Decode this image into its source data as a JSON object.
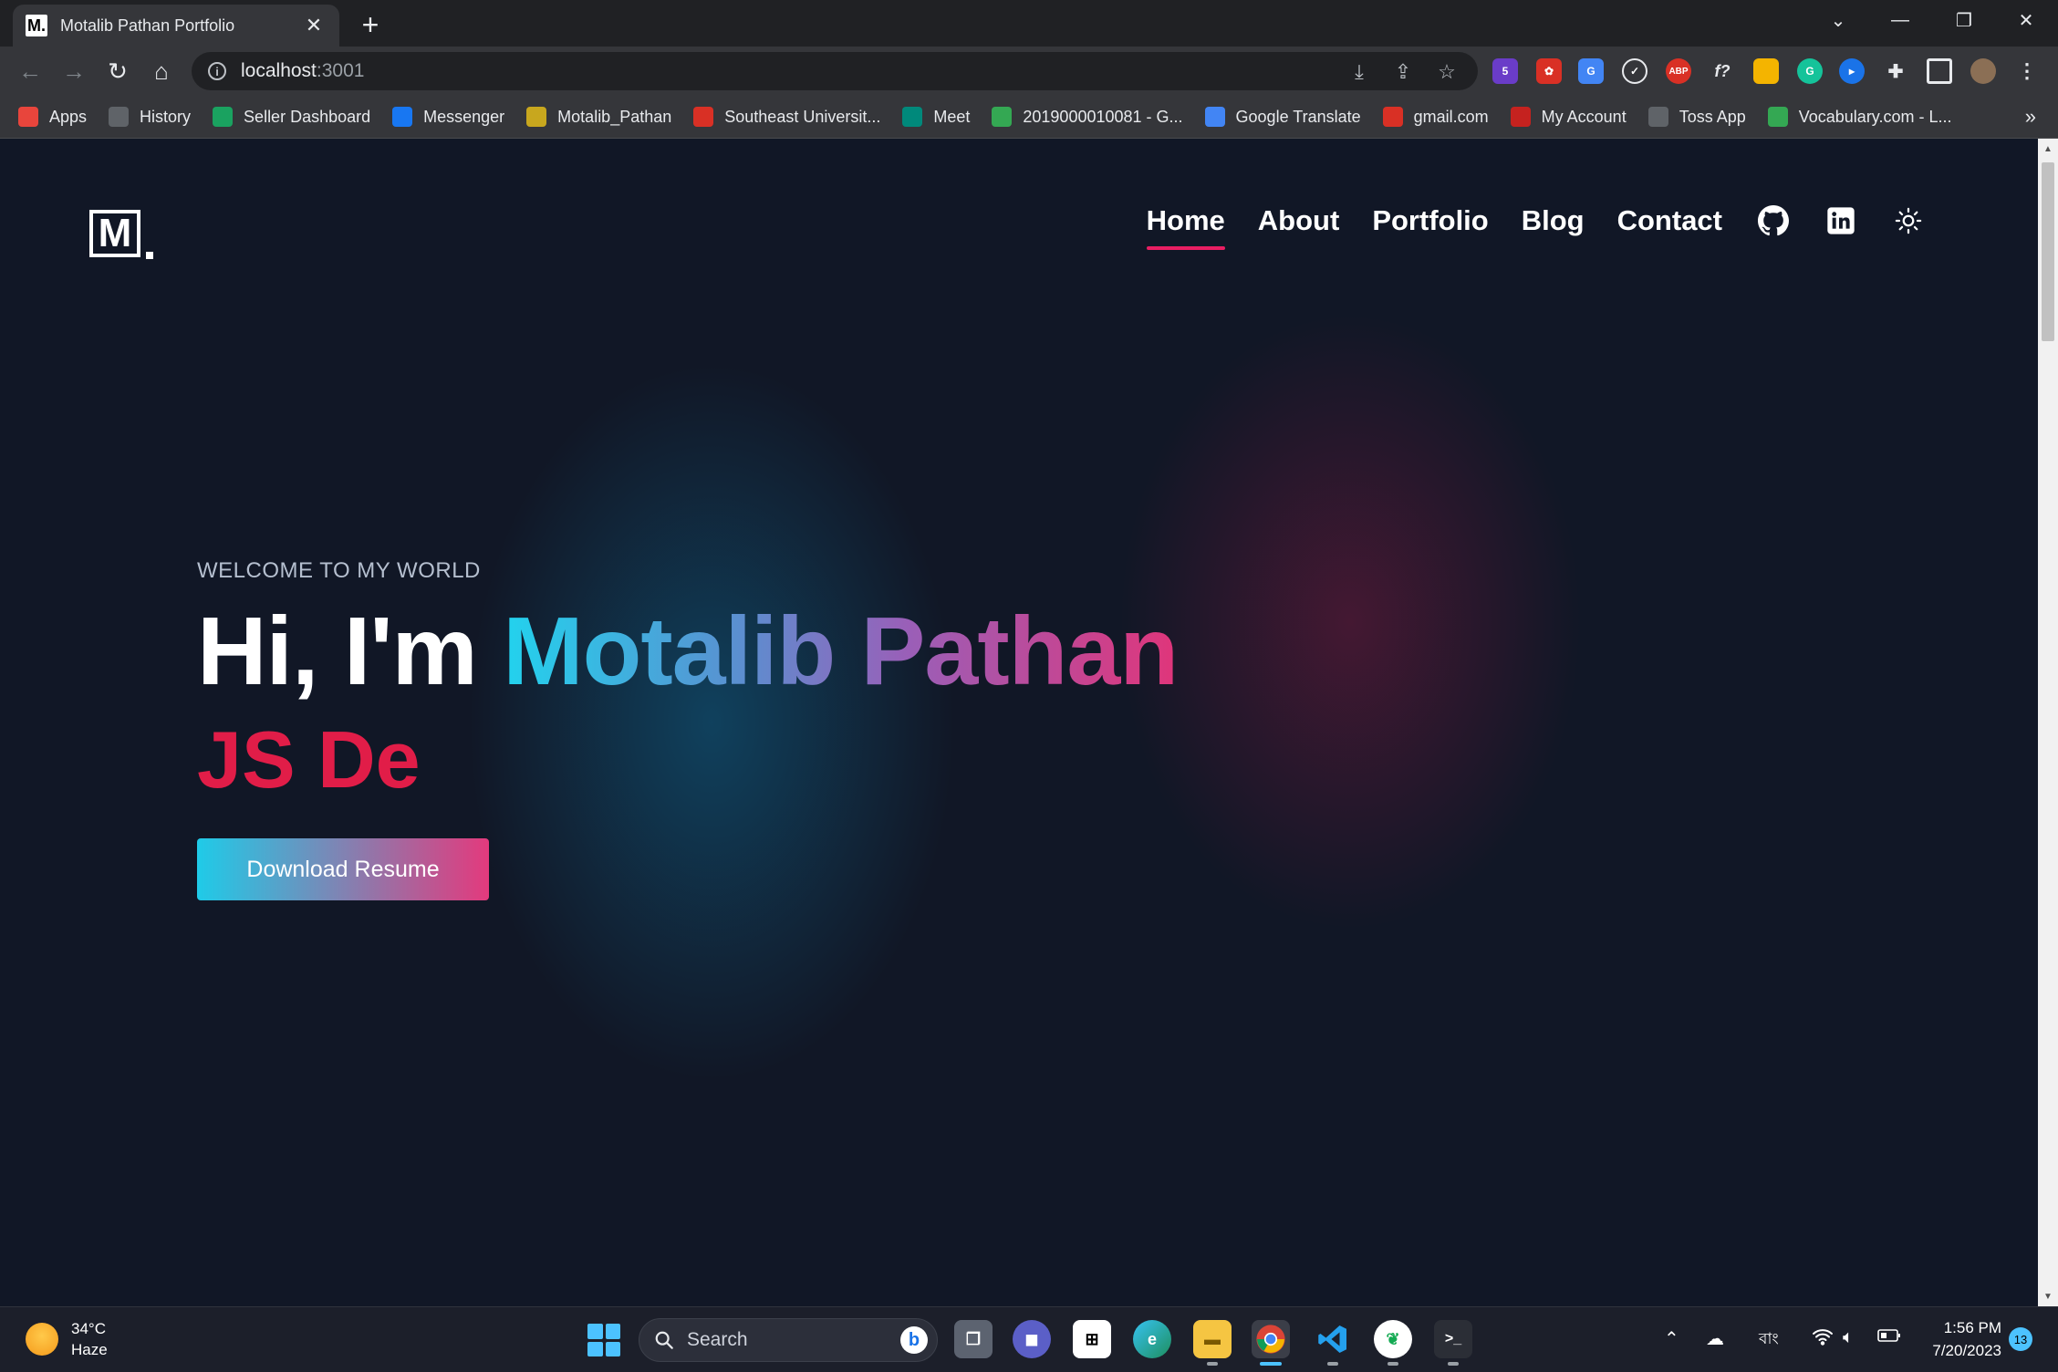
{
  "browser": {
    "tab_title": "Motalib Pathan Portfolio",
    "tab_favicon": "M.",
    "url_host": "localhost",
    "url_port": ":3001"
  },
  "bookmarks": [
    {
      "label": "Apps",
      "icon": "apps-grid-icon",
      "color": "#e8453c"
    },
    {
      "label": "History",
      "icon": "history-icon",
      "color": "#5f6368"
    },
    {
      "label": "Seller Dashboard",
      "icon": "seller-icon",
      "color": "#1aa260"
    },
    {
      "label": "Messenger",
      "icon": "facebook-icon",
      "color": "#1877f2"
    },
    {
      "label": "Motalib_Pathan",
      "icon": "folder-image-icon",
      "color": "#c8a71e"
    },
    {
      "label": "Southeast Universit...",
      "icon": "gmail-icon",
      "color": "#d93025"
    },
    {
      "label": "Meet",
      "icon": "meet-icon",
      "color": "#00897b"
    },
    {
      "label": "2019000010081 - G...",
      "icon": "drive-icon",
      "color": "#34a853"
    },
    {
      "label": "Google Translate",
      "icon": "translate-icon",
      "color": "#4285f4"
    },
    {
      "label": "gmail.com",
      "icon": "gmail-icon",
      "color": "#d93025"
    },
    {
      "label": "My Account",
      "icon": "account-icon",
      "color": "#c5221f"
    },
    {
      "label": "Toss App",
      "icon": "globe-icon",
      "color": "#5f6368"
    },
    {
      "label": "Vocabulary.com - L...",
      "icon": "vocabulary-icon",
      "color": "#34a853"
    }
  ],
  "page": {
    "logo": "M",
    "nav": [
      {
        "label": "Home",
        "active": true
      },
      {
        "label": "About",
        "active": false
      },
      {
        "label": "Portfolio",
        "active": false
      },
      {
        "label": "Blog",
        "active": false
      },
      {
        "label": "Contact",
        "active": false
      }
    ],
    "welcome": "WELCOME TO MY WORLD",
    "greeting": "Hi, I'm ",
    "name": "Motalib Pathan",
    "typed_text": "JS De",
    "resume_button": "Download Resume",
    "accent_color": "#e11d48"
  },
  "taskbar": {
    "temperature": "34°C",
    "weather": "Haze",
    "search_placeholder": "Search",
    "language": "বাং",
    "time": "1:56 PM",
    "date": "7/20/2023",
    "notifications": "13"
  }
}
